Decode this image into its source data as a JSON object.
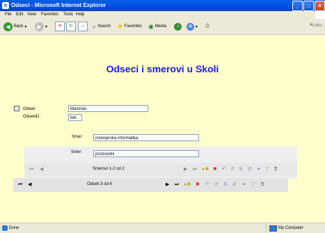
{
  "window": {
    "title": "Odseci - Microsoft Internet Explorer",
    "controls": [
      "minimize",
      "maximize",
      "close"
    ]
  },
  "menu": [
    "File",
    "Edit",
    "View",
    "Favorites",
    "Tools",
    "Help"
  ],
  "toolbar": {
    "back": "Back",
    "search": "Search",
    "favorites": "Favorites",
    "media": "Media",
    "links": "Links"
  },
  "page": {
    "heading": "Odseci i smerovi u Skoli",
    "odsek_label": "Odsek:",
    "odsek_value": "Masinski",
    "odsekid_label": "OdsekID:",
    "odsekid_value": "MA",
    "smer_label": "Smer:",
    "smer_rows": [
      "inzenjerska informatika",
      "proizvodni"
    ],
    "inner_nav_text": "Smerovi 1-2 od 2",
    "outer_nav_text": "Odsek 3 od 6"
  },
  "status": {
    "text": "Done",
    "zone": "My Computer"
  },
  "colors": {
    "page_background": "#ffffcc",
    "heading": "#1a1aff",
    "title_bar": "#0055ea"
  }
}
